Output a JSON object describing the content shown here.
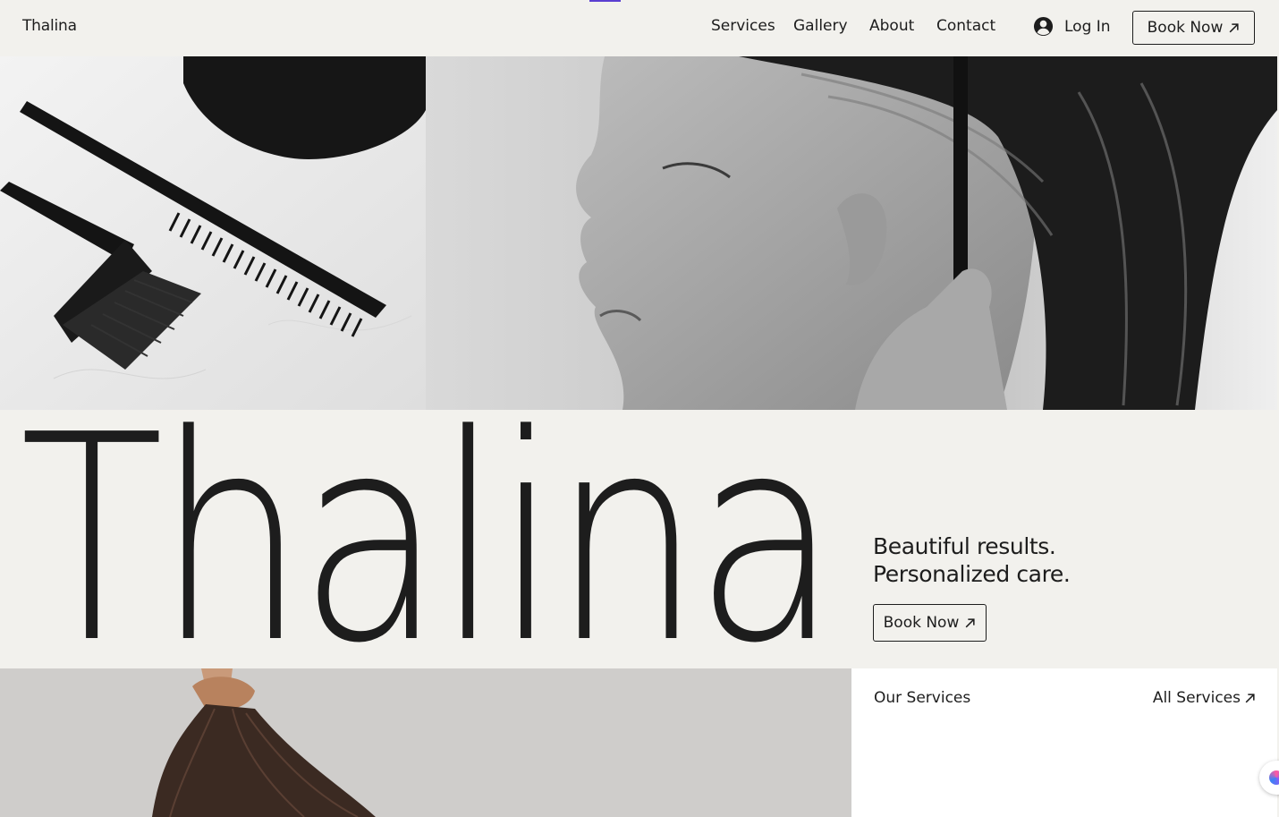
{
  "header": {
    "brand": "Thalina",
    "nav": [
      "Services",
      "Gallery",
      "About",
      "Contact"
    ],
    "login_label": "Log In",
    "book_label": "Book Now",
    "account_icon": "account-circle-icon",
    "arrow_icon": "arrow-up-right-icon"
  },
  "hero": {
    "wordmark": "Thalina",
    "tagline_line1": "Beautiful results.",
    "tagline_line2": "Personalized care.",
    "book_label": "Book Now"
  },
  "services": {
    "title": "Our Services",
    "all_label": "All Services"
  },
  "colors": {
    "background": "#f2f1ed",
    "text": "#1d1d1d",
    "panel": "#ffffff",
    "focus_accent": "#5b3fd1"
  }
}
